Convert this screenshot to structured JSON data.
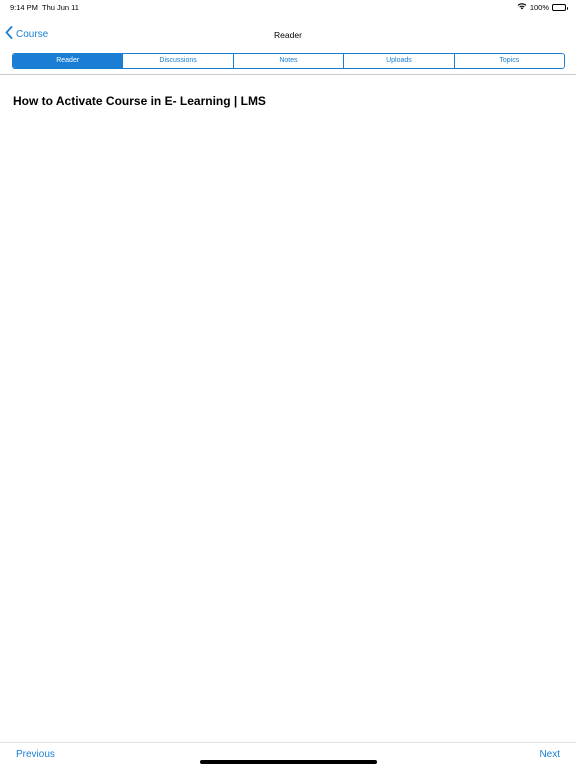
{
  "status_bar": {
    "time": "9:14 PM",
    "date": "Thu Jun 11",
    "battery": "100%",
    "icons": [
      "wifi-icon",
      "battery-icon"
    ]
  },
  "nav": {
    "back_label": "Course",
    "title": "Reader",
    "icons": [
      "chevron-left-icon"
    ]
  },
  "tabs": [
    {
      "label": "Reader",
      "active": true
    },
    {
      "label": "Discussions",
      "active": false
    },
    {
      "label": "Notes",
      "active": false
    },
    {
      "label": "Uploads",
      "active": false
    },
    {
      "label": "Topics",
      "active": false
    }
  ],
  "content": {
    "title": "How to Activate Course in E- Learning | LMS"
  },
  "toolbar": {
    "previous_label": "Previous",
    "next_label": "Next"
  },
  "colors": {
    "accent": "#1a7fd4",
    "background": "#ffffff",
    "divider": "#c8c8c8"
  }
}
